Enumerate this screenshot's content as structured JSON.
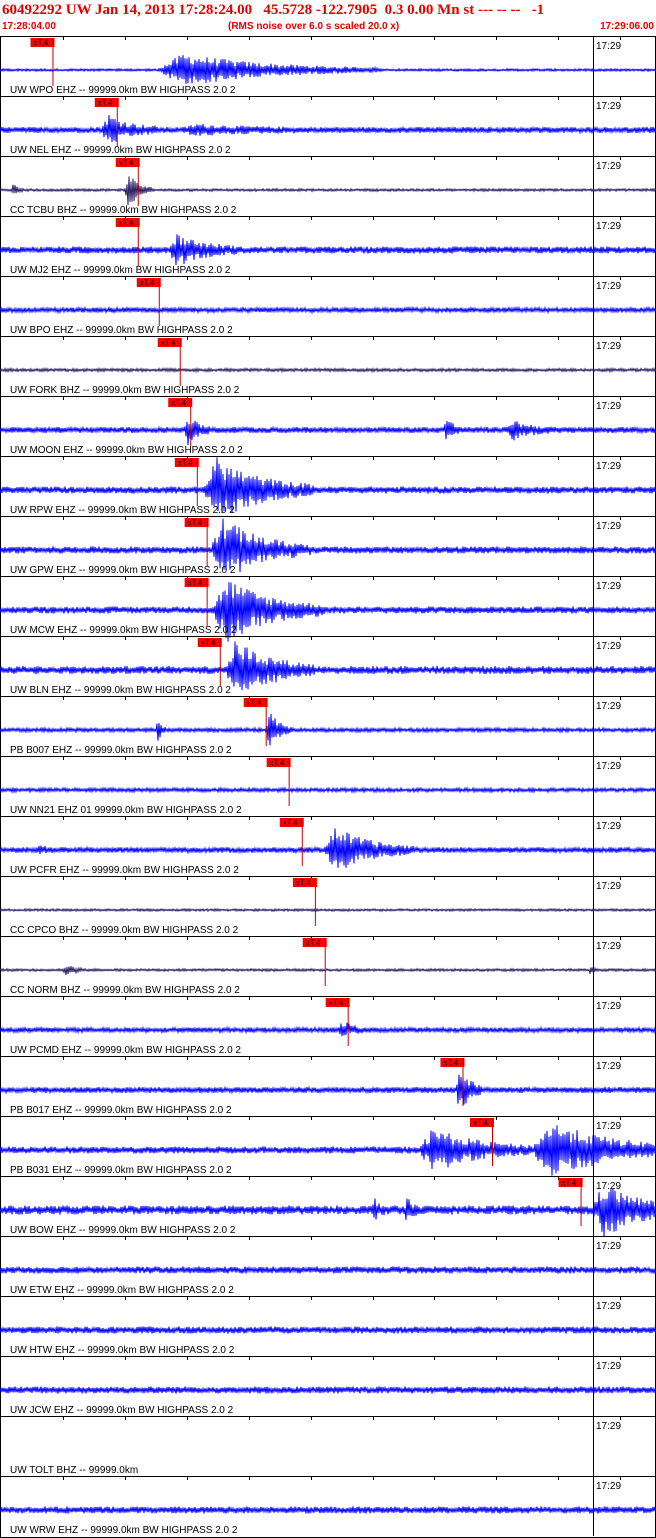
{
  "header": {
    "title": "60492292 UW Jan 14, 2013 17:28:24.00   45.5728 -122.7905  0.3 0.00 Mn st --- -- --   -1",
    "start_time": "17:28:04.00",
    "subtitle": "(RMS noise over 6.0 s scaled 20.0 x)",
    "end_time": "17:29:06.00"
  },
  "colors": {
    "title": "#e00000",
    "trace_main": "#0000ff",
    "trace_dark": "#2a1f63",
    "marker_box": "#ff0000",
    "marker_line": "#c00000",
    "grid": "#000000"
  },
  "chart_data": {
    "type": "line",
    "title": "60492292 UW Jan 14, 2013 17:28:24.00   45.5728 -122.7905  0.3 0.00 Mn st --- -- --   -1",
    "x_start": "17:28:04.00",
    "x_end": "17:29:06.00",
    "minute_label": "17:29",
    "marker_label": "xT.4",
    "series": [
      {
        "label": "UW WPO EHZ -- 99999.0km BW  HIGHPASS  2.0  2",
        "color": "trace_main",
        "arrival": 0.08,
        "events": [
          {
            "t": 0.28,
            "w": 0.1,
            "a": 16
          }
        ],
        "noise": 1.2
      },
      {
        "label": "UW NEL EHZ -- 99999.0km BW  HIGHPASS  2.0  2",
        "color": "trace_main",
        "arrival": 0.178,
        "events": [
          {
            "t": 0.165,
            "w": 0.025,
            "a": 14
          },
          {
            "t": 0.3,
            "w": 0.05,
            "a": 4
          }
        ],
        "noise": 3.0
      },
      {
        "label": "CC TCBU BHZ -- 99999.0km BW  HIGHPASS  2.0  2",
        "color": "trace_dark",
        "arrival": 0.21,
        "events": [
          {
            "t": 0.195,
            "w": 0.012,
            "a": 18
          },
          {
            "t": 0.02,
            "w": 0.005,
            "a": 8
          }
        ],
        "noise": 1.3
      },
      {
        "label": "UW MJ2 EHZ -- 99999.0km BW  HIGHPASS  2.0  2",
        "color": "trace_main",
        "arrival": 0.21,
        "events": [
          {
            "t": 0.27,
            "w": 0.03,
            "a": 14
          }
        ],
        "noise": 3.5
      },
      {
        "label": "UW BPO EHZ -- 99999.0km BW  HIGHPASS  2.0  2",
        "color": "trace_main",
        "arrival": 0.242,
        "events": [],
        "noise": 2.5
      },
      {
        "label": "UW FORK BHZ -- 99999.0km BW  HIGHPASS  2.0  2",
        "color": "trace_dark",
        "arrival": 0.274,
        "events": [],
        "noise": 1.6
      },
      {
        "label": "UW MOON EHZ -- 99999.0km BW  HIGHPASS  2.0  2",
        "color": "trace_main",
        "arrival": 0.29,
        "events": [
          {
            "t": 0.285,
            "w": 0.012,
            "a": 14
          },
          {
            "t": 0.68,
            "w": 0.008,
            "a": 12
          },
          {
            "t": 0.78,
            "w": 0.02,
            "a": 9
          }
        ],
        "noise": 3.0
      },
      {
        "label": "UW RPW EHZ -- 99999.0km BW  HIGHPASS  2.0  2",
        "color": "trace_main",
        "arrival": 0.3,
        "events": [
          {
            "t": 0.33,
            "w": 0.05,
            "a": 30
          }
        ],
        "noise": 3.5
      },
      {
        "label": "UW GPW EHZ -- 99999.0km BW  HIGHPASS  2.0  2",
        "color": "trace_main",
        "arrival": 0.315,
        "events": [
          {
            "t": 0.34,
            "w": 0.045,
            "a": 30
          }
        ],
        "noise": 3.5
      },
      {
        "label": "UW MCW EHZ -- 99999.0km BW  HIGHPASS  2.0  2",
        "color": "trace_main",
        "arrival": 0.315,
        "events": [
          {
            "t": 0.345,
            "w": 0.05,
            "a": 30
          }
        ],
        "noise": 3.5
      },
      {
        "label": "UW BLN EHZ -- 99999.0km BW  HIGHPASS  2.0  2",
        "color": "trace_main",
        "arrival": 0.335,
        "events": [
          {
            "t": 0.36,
            "w": 0.04,
            "a": 28
          }
        ],
        "noise": 4.0
      },
      {
        "label": "PB B007 EHZ -- 99999.0km BW  HIGHPASS  2.0  2",
        "color": "trace_main",
        "arrival": 0.405,
        "events": [
          {
            "t": 0.24,
            "w": 0.004,
            "a": 14
          },
          {
            "t": 0.41,
            "w": 0.012,
            "a": 18
          }
        ],
        "noise": 2.0
      },
      {
        "label": "UW NN21 EHZ 01 99999.0km BW  HIGHPASS  2.0  2",
        "color": "trace_main",
        "arrival": 0.44,
        "events": [],
        "noise": 2.0
      },
      {
        "label": "UW PCFR EHZ -- 99999.0km BW  HIGHPASS  2.0  2",
        "color": "trace_main",
        "arrival": 0.46,
        "events": [
          {
            "t": 0.51,
            "w": 0.04,
            "a": 22
          },
          {
            "t": 0.06,
            "w": 0.005,
            "a": 6
          }
        ],
        "noise": 2.8
      },
      {
        "label": "CC CPCO BHZ -- 99999.0km BW  HIGHPASS  2.0  2",
        "color": "trace_dark",
        "arrival": 0.48,
        "events": [],
        "noise": 1.2
      },
      {
        "label": "CC NORM BHZ -- 99999.0km BW  HIGHPASS  2.0  2",
        "color": "trace_dark",
        "arrival": 0.495,
        "events": [
          {
            "t": 0.1,
            "w": 0.01,
            "a": 5
          },
          {
            "t": 0.9,
            "w": 0.004,
            "a": 5
          }
        ],
        "noise": 1.3
      },
      {
        "label": "UW PCMD EHZ -- 99999.0km BW  HIGHPASS  2.0  2",
        "color": "trace_main",
        "arrival": 0.53,
        "events": [
          {
            "t": 0.52,
            "w": 0.012,
            "a": 9
          }
        ],
        "noise": 2.5
      },
      {
        "label": "PB B017 EHZ -- 99999.0km BW  HIGHPASS  2.0  2",
        "color": "trace_main",
        "arrival": 0.705,
        "events": [
          {
            "t": 0.7,
            "w": 0.012,
            "a": 22
          }
        ],
        "noise": 3.0
      },
      {
        "label": "PB B031 EHZ -- 99999.0km BW  HIGHPASS  2.0  2",
        "color": "trace_main",
        "arrival": 0.75,
        "events": [
          {
            "t": 0.66,
            "w": 0.05,
            "a": 20
          },
          {
            "t": 0.84,
            "w": 0.07,
            "a": 26
          }
        ],
        "noise": 3.5
      },
      {
        "label": "UW BOW EHZ -- 99999.0km BW  HIGHPASS  2.0  2",
        "color": "trace_main",
        "arrival": 0.885,
        "events": [
          {
            "t": 0.92,
            "w": 0.04,
            "a": 24
          },
          {
            "t": 0.57,
            "w": 0.006,
            "a": 10
          },
          {
            "t": 0.62,
            "w": 0.006,
            "a": 10
          }
        ],
        "noise": 4.5
      },
      {
        "label": "UW ETW EHZ -- 99999.0km BW  HIGHPASS  2.0  2",
        "color": "trace_main",
        "arrival": null,
        "events": [],
        "noise": 3.5
      },
      {
        "label": "UW HTW EHZ -- 99999.0km BW  HIGHPASS  2.0  2",
        "color": "trace_main",
        "arrival": null,
        "events": [],
        "noise": 3.5
      },
      {
        "label": "UW JCW EHZ -- 99999.0km BW  HIGHPASS  2.0  2",
        "color": "trace_main",
        "arrival": null,
        "events": [],
        "noise": 3.5
      },
      {
        "label": "UW TOLT BHZ -- 99999.0km",
        "color": "trace_main",
        "arrival": null,
        "events": [],
        "noise": 0
      },
      {
        "label": "UW WRW EHZ -- 99999.0km BW  HIGHPASS  2.0  2",
        "color": "trace_main",
        "arrival": null,
        "events": [],
        "noise": 3.5
      }
    ]
  }
}
